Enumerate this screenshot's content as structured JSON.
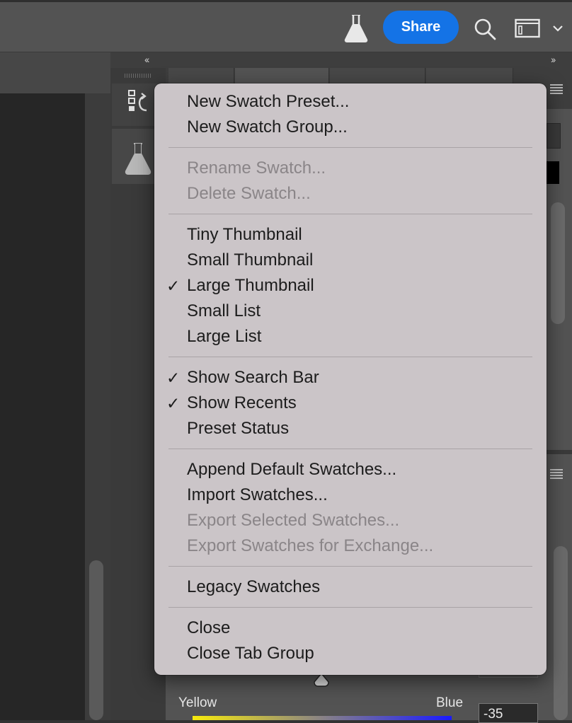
{
  "topbar": {
    "share_label": "Share",
    "icons": [
      "flask-icon",
      "search-icon",
      "workspace-icon",
      "chevron-down-icon"
    ],
    "share_color": "#1473e6"
  },
  "collapse": {
    "left_label": "‹‹",
    "right_label": "››"
  },
  "menu": {
    "groups": [
      [
        {
          "label": "New Swatch Preset...",
          "enabled": true,
          "checked": false
        },
        {
          "label": "New Swatch Group...",
          "enabled": true,
          "checked": false
        }
      ],
      [
        {
          "label": "Rename Swatch...",
          "enabled": false,
          "checked": false
        },
        {
          "label": "Delete Swatch...",
          "enabled": false,
          "checked": false
        }
      ],
      [
        {
          "label": "Tiny Thumbnail",
          "enabled": true,
          "checked": false
        },
        {
          "label": "Small Thumbnail",
          "enabled": true,
          "checked": false
        },
        {
          "label": "Large Thumbnail",
          "enabled": true,
          "checked": true
        },
        {
          "label": "Small List",
          "enabled": true,
          "checked": false
        },
        {
          "label": "Large List",
          "enabled": true,
          "checked": false
        }
      ],
      [
        {
          "label": "Show Search Bar",
          "enabled": true,
          "checked": true
        },
        {
          "label": "Show Recents",
          "enabled": true,
          "checked": true
        },
        {
          "label": "Preset Status",
          "enabled": true,
          "checked": false
        }
      ],
      [
        {
          "label": "Append Default Swatches...",
          "enabled": true,
          "checked": false
        },
        {
          "label": "Import Swatches...",
          "enabled": true,
          "checked": false
        },
        {
          "label": "Export Selected Swatches...",
          "enabled": false,
          "checked": false
        },
        {
          "label": "Export Swatches for Exchange...",
          "enabled": false,
          "checked": false
        }
      ],
      [
        {
          "label": "Legacy Swatches",
          "enabled": true,
          "checked": false
        }
      ],
      [
        {
          "label": "Close",
          "enabled": true,
          "checked": false
        },
        {
          "label": "Close Tab Group",
          "enabled": true,
          "checked": false
        }
      ]
    ],
    "check_glyph": "✓"
  },
  "color_balance": {
    "left_label": "Yellow",
    "right_label": "Blue",
    "value": "-35",
    "gradient_colors": [
      "#f7ea0c",
      "#1a1aff"
    ]
  }
}
